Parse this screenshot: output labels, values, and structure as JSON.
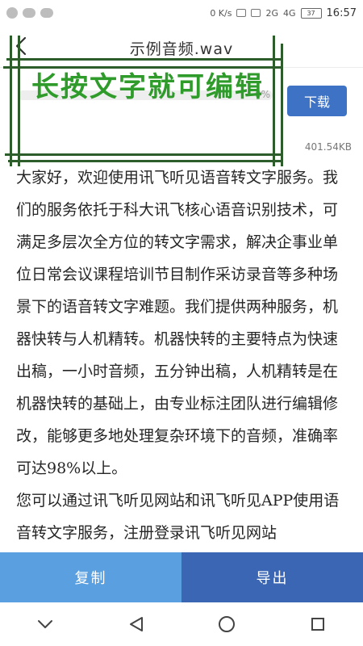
{
  "status_bar": {
    "network_speed": "0 K/s",
    "signal_left": "2G",
    "signal_right": "4G",
    "battery": "37",
    "time": "16:57"
  },
  "header": {
    "title": "示例音频.wav",
    "back_icon": "chevron-left-icon"
  },
  "download": {
    "progress_percent_label": "0%",
    "progress": 0,
    "button_label": "下载",
    "file_size": "401.54KB"
  },
  "annotation": {
    "text": "长按文字就可编辑",
    "color": "#2f9b2b",
    "frame_color": "#2c5d2b"
  },
  "transcript": {
    "paragraphs": [
      "大家好，欢迎使用讯飞听见语音转文字服务。我们的服务依托于科大讯飞核心语音识别技术，可满足多层次全方位的转文字需求，解决企事业单位日常会议课程培训节目制作采访录音等多种场景下的语音转文字难题。我们提供两种服务，机器快转与人机精转。机器快转的主要特点为快速出稿，一小时音频，五分钟出稿，人机精转是在机器快转的基础上，由专业标注团队进行编辑修改，能够更多地处理复杂环境下的音频，准确率可达98%以上。",
      "您可以通过讯飞听见网站和讯飞听见APP使用语音转文字服务，注册登录讯飞听见网站"
    ]
  },
  "actions": {
    "copy_label": "复制",
    "export_label": "导出",
    "copy_color": "#5a9fe0",
    "export_color": "#3a66b4"
  },
  "nav_bar": {
    "items": [
      "hide-keyboard-icon",
      "back-triangle-icon",
      "home-circle-icon",
      "recents-square-icon"
    ]
  }
}
